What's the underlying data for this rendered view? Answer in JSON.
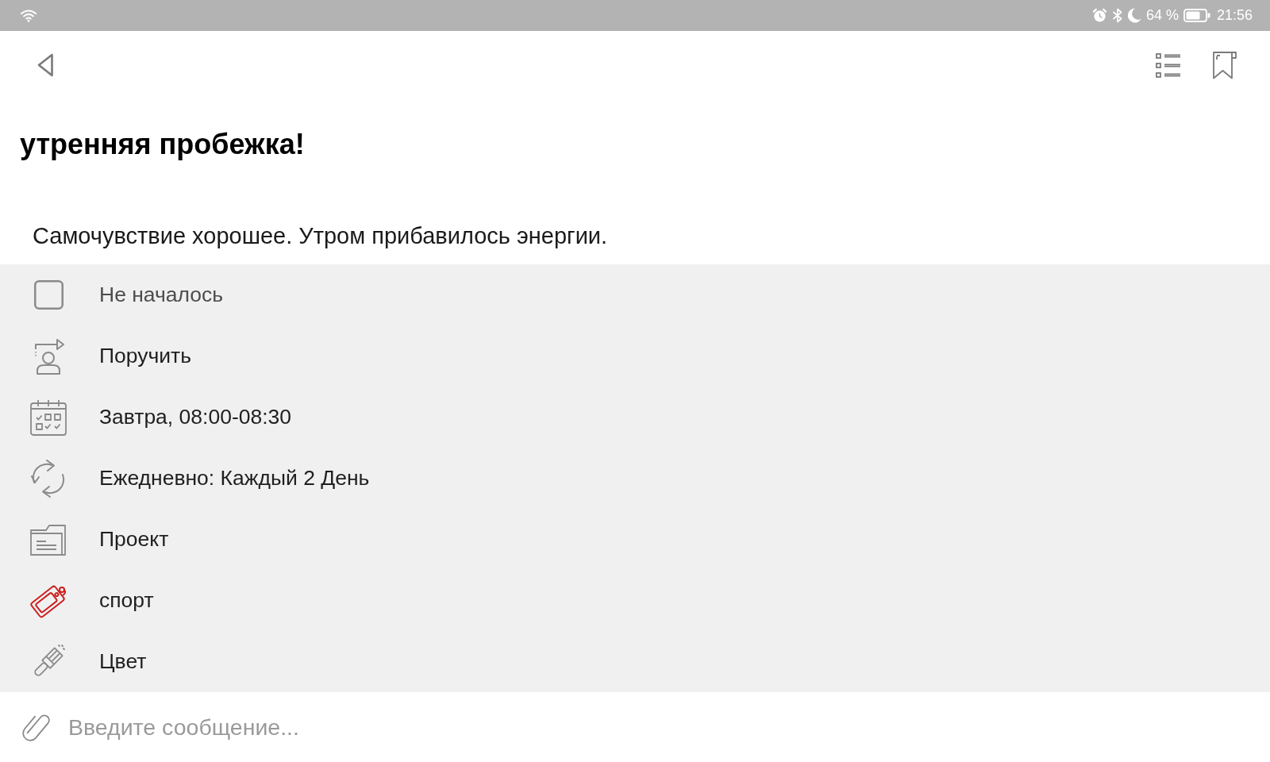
{
  "status_bar": {
    "battery_percent": "64 %",
    "time": "21:56"
  },
  "task": {
    "title": "утренняя пробежка!",
    "description": "Самочувствие хорошее. Утром прибавилось энергии."
  },
  "details": [
    {
      "kind": "status",
      "label": "Не началось",
      "checked": false
    },
    {
      "kind": "assign",
      "label": "Поручить"
    },
    {
      "kind": "schedule",
      "label": "Завтра, 08:00-08:30"
    },
    {
      "kind": "repeat",
      "label": "Ежедневно: Каждый 2 День"
    },
    {
      "kind": "project",
      "label": "Проект"
    },
    {
      "kind": "tag",
      "label": "спорт",
      "color": "#cc1f1f"
    },
    {
      "kind": "color",
      "label": "Цвет"
    }
  ],
  "composer": {
    "placeholder": "Введите сообщение..."
  }
}
